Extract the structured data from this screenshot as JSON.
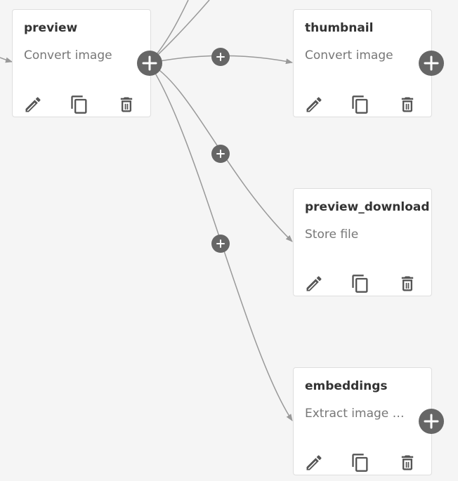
{
  "nodes": [
    {
      "id": "preview",
      "title": "preview",
      "subtitle": "Convert image"
    },
    {
      "id": "thumbnail",
      "title": "thumbnail",
      "subtitle": "Convert image"
    },
    {
      "id": "preview_download",
      "title": "preview_download",
      "subtitle": "Store file"
    },
    {
      "id": "embeddings",
      "title": "embeddings",
      "subtitle": "Extract image e..."
    }
  ],
  "icons": {
    "edit": "pencil-icon",
    "copy": "copy-icon",
    "delete": "trash-icon",
    "add": "plus-icon"
  },
  "colors": {
    "canvas": "#f5f5f5",
    "node_bg": "#ffffff",
    "node_border": "#dedede",
    "edge": "#999999",
    "add_button": "#666666",
    "icon": "#555555"
  }
}
